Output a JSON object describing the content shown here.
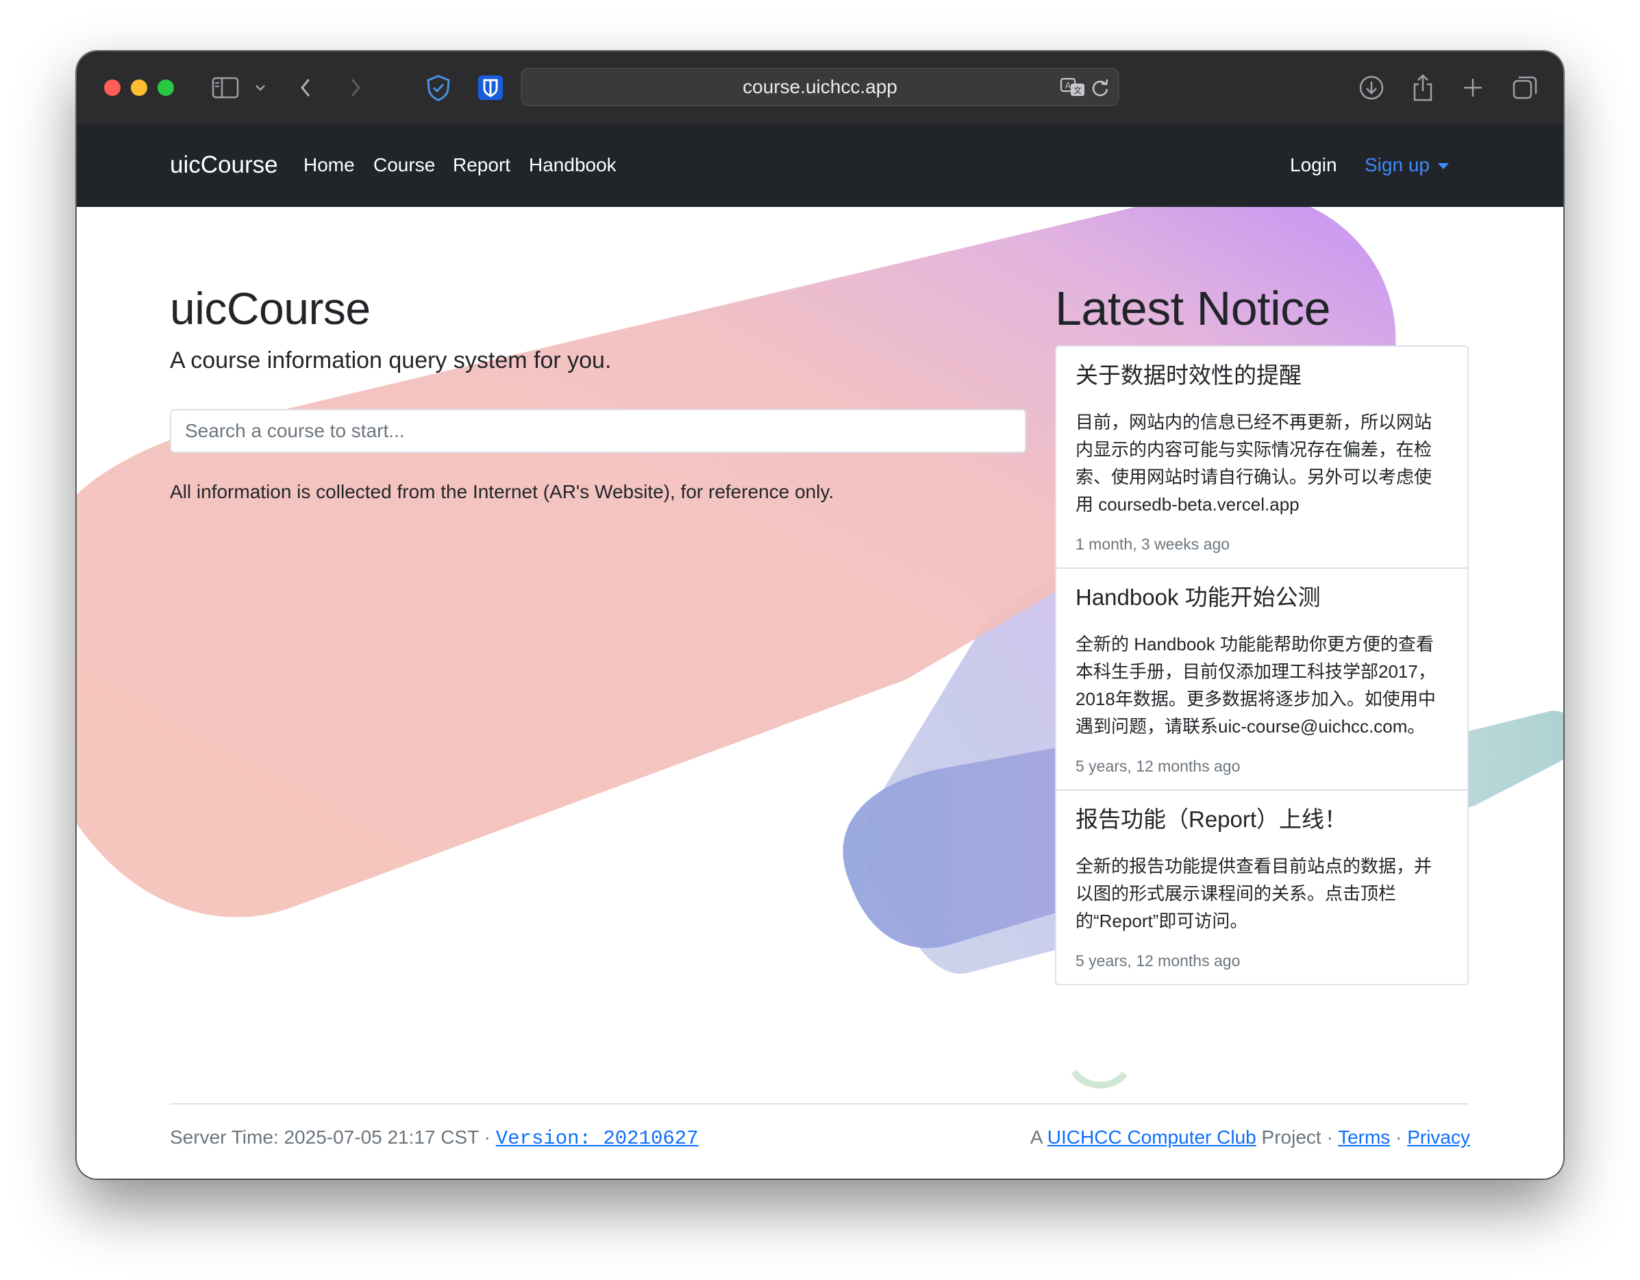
{
  "browser": {
    "url": "course.uichcc.app"
  },
  "navbar": {
    "brand": "uicCourse",
    "links": [
      "Home",
      "Course",
      "Report",
      "Handbook"
    ],
    "login": "Login",
    "signup": "Sign up"
  },
  "hero": {
    "title": "uicCourse",
    "subtitle": "A course information query system for you.",
    "search_placeholder": "Search a course to start...",
    "note": "All information is collected from the Internet (AR's Website), for reference only."
  },
  "notices": {
    "heading": "Latest Notice",
    "items": [
      {
        "title": "关于数据时效性的提醒",
        "body": "目前，网站内的信息已经不再更新，所以网站内显示的内容可能与实际情况存在偏差，在检索、使用网站时请自行确认。另外可以考虑使用 coursedb-beta.vercel.app",
        "time": "1 month, 3 weeks ago"
      },
      {
        "title": "Handbook 功能开始公测",
        "body": "全新的 Handbook 功能能帮助你更方便的查看本科生手册，目前仅添加理工科技学部2017，2018年数据。更多数据将逐步加入。如使用中遇到问题，请联系uic-course@uichcc.com。",
        "time": "5 years, 12 months ago"
      },
      {
        "title": "报告功能（Report）上线！",
        "body": "全新的报告功能提供查看目前站点的数据，并以图的形式展示课程间的关系。点击顶栏的“Report”即可访问。",
        "time": "5 years, 12 months ago"
      }
    ]
  },
  "footer": {
    "server_time": "Server Time: 2025-07-05 21:17 CST",
    "separator": "·",
    "version": "Version: 20210627",
    "project_prefix": "A",
    "club": "UICHCC Computer Club",
    "project_suffix": "Project",
    "terms": "Terms",
    "privacy": "Privacy"
  },
  "colors": {
    "navbar_bg": "#212529",
    "link_blue": "#0d6efd",
    "signup_blue": "#3d8bfd",
    "blob_pink": "#f5c3ba",
    "blob_purple": "#c18cf5",
    "blob_blue": "#9aa9dd",
    "blob_teal": "#9ec9c9"
  }
}
